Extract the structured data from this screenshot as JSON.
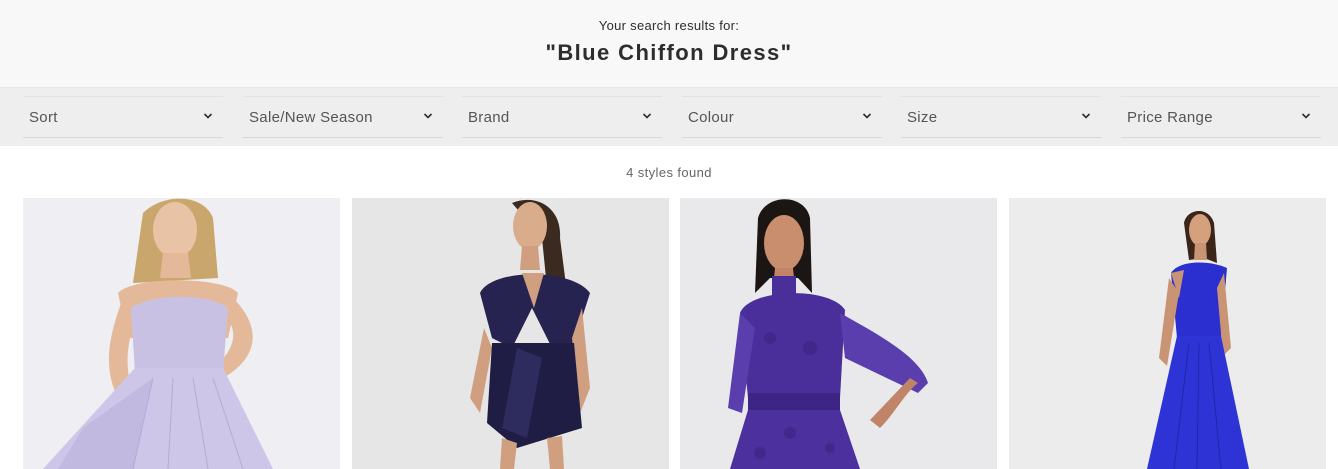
{
  "search": {
    "prefix": "Your search results for:",
    "term": "\"Blue Chiffon Dress\""
  },
  "filters": [
    {
      "label": "Sort"
    },
    {
      "label": "Sale/New Season"
    },
    {
      "label": "Brand"
    },
    {
      "label": "Colour"
    },
    {
      "label": "Size"
    },
    {
      "label": "Price Range"
    }
  ],
  "results": {
    "count_text": "4 styles found"
  },
  "products": [
    {
      "image": "lilac-strapless-pleated-maxi-dress",
      "dress_color": "#c9c1e4"
    },
    {
      "image": "navy-satin-wrap-mini-dress",
      "dress_color": "#232049"
    },
    {
      "image": "purple-lace-high-neck-dress",
      "dress_color": "#4a2f9a"
    },
    {
      "image": "cobalt-one-shoulder-maxi-dress",
      "dress_color": "#2b2fcf"
    }
  ]
}
